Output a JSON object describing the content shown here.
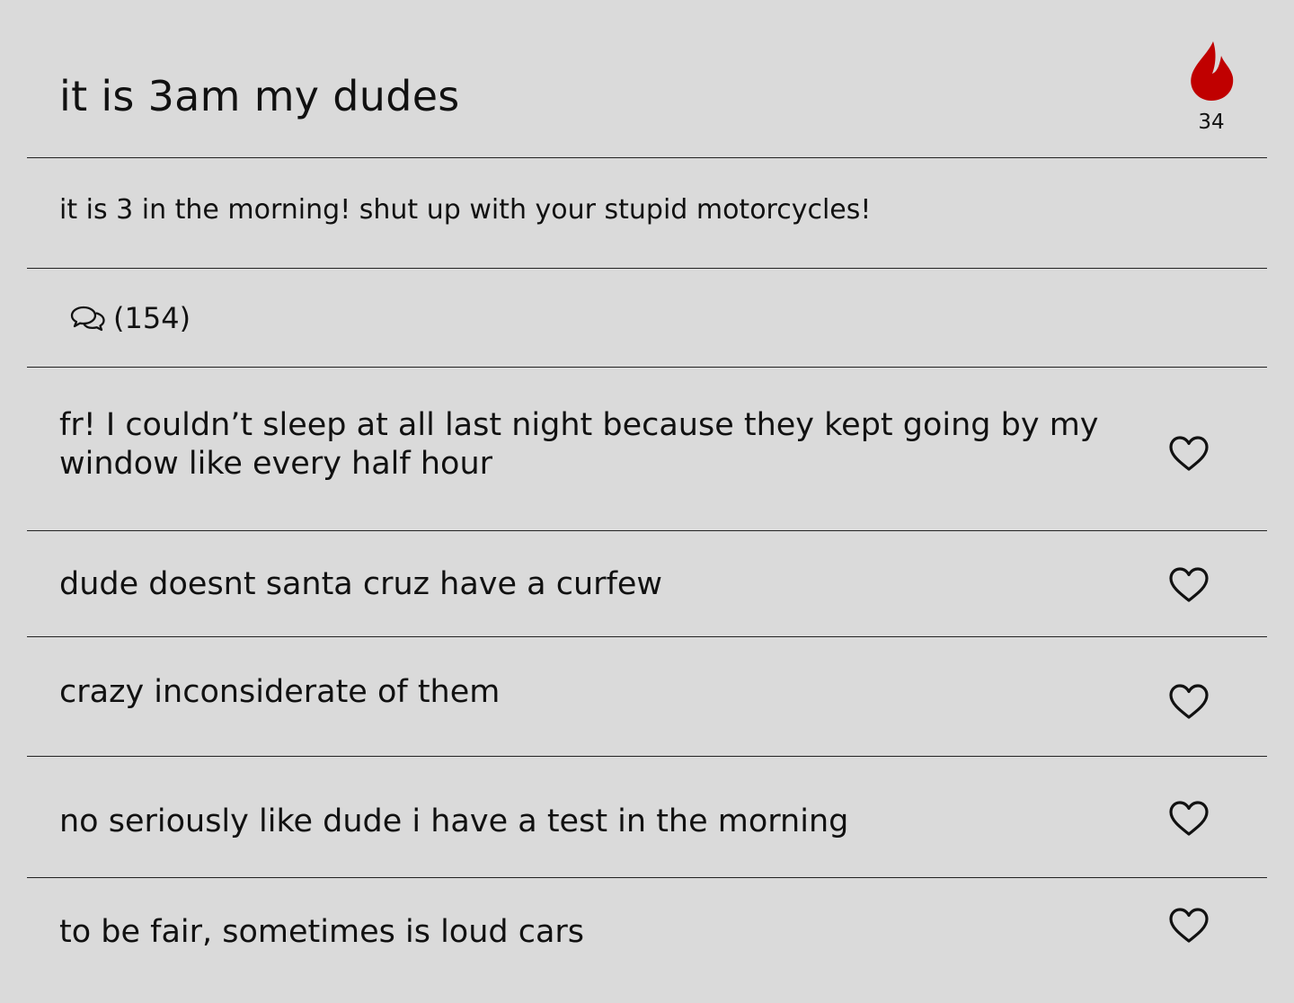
{
  "post": {
    "title": "it is 3am my dudes",
    "body": "it is 3 in the morning! shut up with your stupid motorcycles!",
    "heat_count": "34",
    "comments_count": "(154)"
  },
  "comments": [
    {
      "text": "fr! I couldn’t sleep at all last night because they kept going by my window like every half hour"
    },
    {
      "text": "dude doesnt santa cruz have a curfew"
    },
    {
      "text": "crazy inconsiderate of them"
    },
    {
      "text": "no seriously like dude i have a test in the morning"
    },
    {
      "text": "to be fair, sometimes is loud cars"
    }
  ],
  "icons": {
    "heat": "flame-icon",
    "comments": "chat-bubbles-icon",
    "like": "heart-icon"
  },
  "colors": {
    "background": "#dadada",
    "flame": "#c00000",
    "text": "#111111"
  }
}
